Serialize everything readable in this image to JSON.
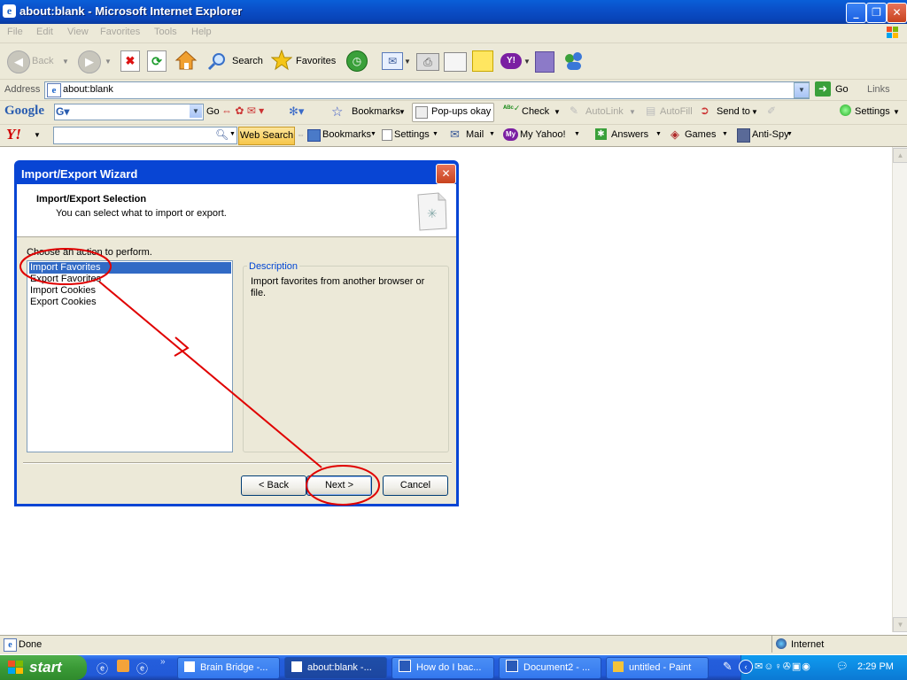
{
  "window": {
    "title": "about:blank - Microsoft Internet Explorer"
  },
  "menu": [
    "File",
    "Edit",
    "View",
    "Favorites",
    "Tools",
    "Help"
  ],
  "toolbar": {
    "back": "Back",
    "search": "Search",
    "favorites": "Favorites"
  },
  "address": {
    "label": "Address",
    "value": "about:blank",
    "go": "Go",
    "links": "Links"
  },
  "google_bar": {
    "logo": "Google",
    "go": "Go",
    "bookmarks": "Bookmarks",
    "popups": "Pop-ups okay",
    "check": "Check",
    "autolink": "AutoLink",
    "autofill": "AutoFill",
    "send_to": "Send to",
    "settings": "Settings"
  },
  "yahoo_bar": {
    "web_search": "Web Search",
    "bookmarks": "Bookmarks",
    "settings": "Settings",
    "mail": "Mail",
    "my_yahoo": "My Yahoo!",
    "answers": "Answers",
    "games": "Games",
    "anti_spy": "Anti-Spy"
  },
  "dialog": {
    "title": "Import/Export Wizard",
    "heading": "Import/Export Selection",
    "subheading": "You can select what to import or export.",
    "list_label": "Choose an action to perform.",
    "items": [
      "Import Favorites",
      "Export Favorites",
      "Import Cookies",
      "Export Cookies"
    ],
    "selected_index": 0,
    "description_label": "Description",
    "description": "Import favorites from another browser or file.",
    "buttons": {
      "back": "< Back",
      "next": "Next >",
      "cancel": "Cancel"
    }
  },
  "status": {
    "text": "Done",
    "zone": "Internet"
  },
  "taskbar": {
    "start": "start",
    "tasks": [
      "Brain Bridge -...",
      "about:blank -...",
      "How do I bac...",
      "Document2 - ...",
      "untitled - Paint"
    ],
    "active_index": 1,
    "clock": "2:29 PM"
  },
  "colors": {
    "annotation": "#e00000",
    "selection": "#316ac5",
    "xp_blue": "#0845d4"
  }
}
